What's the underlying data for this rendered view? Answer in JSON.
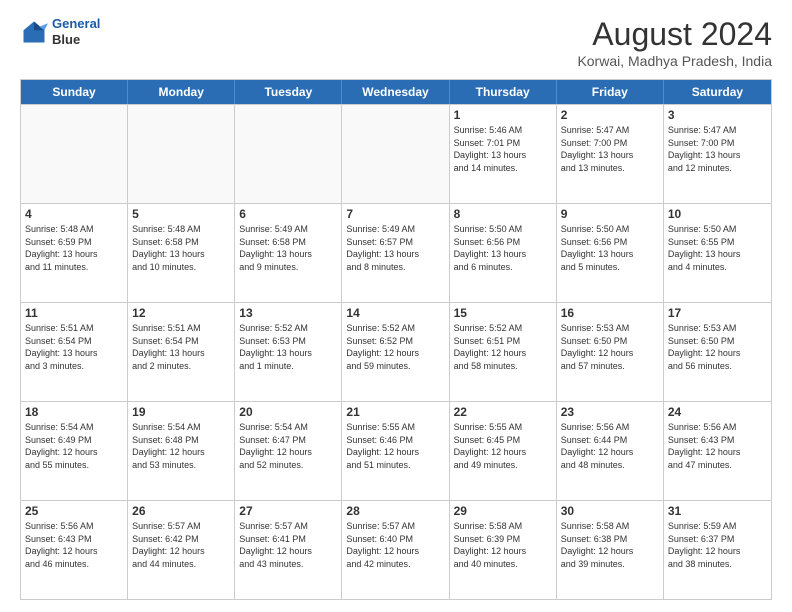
{
  "header": {
    "logo_line1": "General",
    "logo_line2": "Blue",
    "title": "August 2024",
    "subtitle": "Korwai, Madhya Pradesh, India"
  },
  "weekdays": [
    "Sunday",
    "Monday",
    "Tuesday",
    "Wednesday",
    "Thursday",
    "Friday",
    "Saturday"
  ],
  "weeks": [
    [
      {
        "day": "",
        "info": "",
        "empty": true
      },
      {
        "day": "",
        "info": "",
        "empty": true
      },
      {
        "day": "",
        "info": "",
        "empty": true
      },
      {
        "day": "",
        "info": "",
        "empty": true
      },
      {
        "day": "1",
        "info": "Sunrise: 5:46 AM\nSunset: 7:01 PM\nDaylight: 13 hours\nand 14 minutes.",
        "empty": false
      },
      {
        "day": "2",
        "info": "Sunrise: 5:47 AM\nSunset: 7:00 PM\nDaylight: 13 hours\nand 13 minutes.",
        "empty": false
      },
      {
        "day": "3",
        "info": "Sunrise: 5:47 AM\nSunset: 7:00 PM\nDaylight: 13 hours\nand 12 minutes.",
        "empty": false
      }
    ],
    [
      {
        "day": "4",
        "info": "Sunrise: 5:48 AM\nSunset: 6:59 PM\nDaylight: 13 hours\nand 11 minutes.",
        "empty": false
      },
      {
        "day": "5",
        "info": "Sunrise: 5:48 AM\nSunset: 6:58 PM\nDaylight: 13 hours\nand 10 minutes.",
        "empty": false
      },
      {
        "day": "6",
        "info": "Sunrise: 5:49 AM\nSunset: 6:58 PM\nDaylight: 13 hours\nand 9 minutes.",
        "empty": false
      },
      {
        "day": "7",
        "info": "Sunrise: 5:49 AM\nSunset: 6:57 PM\nDaylight: 13 hours\nand 8 minutes.",
        "empty": false
      },
      {
        "day": "8",
        "info": "Sunrise: 5:50 AM\nSunset: 6:56 PM\nDaylight: 13 hours\nand 6 minutes.",
        "empty": false
      },
      {
        "day": "9",
        "info": "Sunrise: 5:50 AM\nSunset: 6:56 PM\nDaylight: 13 hours\nand 5 minutes.",
        "empty": false
      },
      {
        "day": "10",
        "info": "Sunrise: 5:50 AM\nSunset: 6:55 PM\nDaylight: 13 hours\nand 4 minutes.",
        "empty": false
      }
    ],
    [
      {
        "day": "11",
        "info": "Sunrise: 5:51 AM\nSunset: 6:54 PM\nDaylight: 13 hours\nand 3 minutes.",
        "empty": false
      },
      {
        "day": "12",
        "info": "Sunrise: 5:51 AM\nSunset: 6:54 PM\nDaylight: 13 hours\nand 2 minutes.",
        "empty": false
      },
      {
        "day": "13",
        "info": "Sunrise: 5:52 AM\nSunset: 6:53 PM\nDaylight: 13 hours\nand 1 minute.",
        "empty": false
      },
      {
        "day": "14",
        "info": "Sunrise: 5:52 AM\nSunset: 6:52 PM\nDaylight: 12 hours\nand 59 minutes.",
        "empty": false
      },
      {
        "day": "15",
        "info": "Sunrise: 5:52 AM\nSunset: 6:51 PM\nDaylight: 12 hours\nand 58 minutes.",
        "empty": false
      },
      {
        "day": "16",
        "info": "Sunrise: 5:53 AM\nSunset: 6:50 PM\nDaylight: 12 hours\nand 57 minutes.",
        "empty": false
      },
      {
        "day": "17",
        "info": "Sunrise: 5:53 AM\nSunset: 6:50 PM\nDaylight: 12 hours\nand 56 minutes.",
        "empty": false
      }
    ],
    [
      {
        "day": "18",
        "info": "Sunrise: 5:54 AM\nSunset: 6:49 PM\nDaylight: 12 hours\nand 55 minutes.",
        "empty": false
      },
      {
        "day": "19",
        "info": "Sunrise: 5:54 AM\nSunset: 6:48 PM\nDaylight: 12 hours\nand 53 minutes.",
        "empty": false
      },
      {
        "day": "20",
        "info": "Sunrise: 5:54 AM\nSunset: 6:47 PM\nDaylight: 12 hours\nand 52 minutes.",
        "empty": false
      },
      {
        "day": "21",
        "info": "Sunrise: 5:55 AM\nSunset: 6:46 PM\nDaylight: 12 hours\nand 51 minutes.",
        "empty": false
      },
      {
        "day": "22",
        "info": "Sunrise: 5:55 AM\nSunset: 6:45 PM\nDaylight: 12 hours\nand 49 minutes.",
        "empty": false
      },
      {
        "day": "23",
        "info": "Sunrise: 5:56 AM\nSunset: 6:44 PM\nDaylight: 12 hours\nand 48 minutes.",
        "empty": false
      },
      {
        "day": "24",
        "info": "Sunrise: 5:56 AM\nSunset: 6:43 PM\nDaylight: 12 hours\nand 47 minutes.",
        "empty": false
      }
    ],
    [
      {
        "day": "25",
        "info": "Sunrise: 5:56 AM\nSunset: 6:43 PM\nDaylight: 12 hours\nand 46 minutes.",
        "empty": false
      },
      {
        "day": "26",
        "info": "Sunrise: 5:57 AM\nSunset: 6:42 PM\nDaylight: 12 hours\nand 44 minutes.",
        "empty": false
      },
      {
        "day": "27",
        "info": "Sunrise: 5:57 AM\nSunset: 6:41 PM\nDaylight: 12 hours\nand 43 minutes.",
        "empty": false
      },
      {
        "day": "28",
        "info": "Sunrise: 5:57 AM\nSunset: 6:40 PM\nDaylight: 12 hours\nand 42 minutes.",
        "empty": false
      },
      {
        "day": "29",
        "info": "Sunrise: 5:58 AM\nSunset: 6:39 PM\nDaylight: 12 hours\nand 40 minutes.",
        "empty": false
      },
      {
        "day": "30",
        "info": "Sunrise: 5:58 AM\nSunset: 6:38 PM\nDaylight: 12 hours\nand 39 minutes.",
        "empty": false
      },
      {
        "day": "31",
        "info": "Sunrise: 5:59 AM\nSunset: 6:37 PM\nDaylight: 12 hours\nand 38 minutes.",
        "empty": false
      }
    ]
  ]
}
